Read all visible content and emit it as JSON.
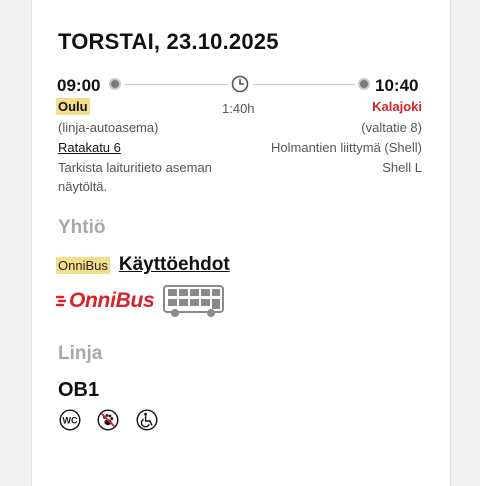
{
  "trip": {
    "date": "TORSTAI, 23.10.2025",
    "departure_time": "09:00",
    "arrival_time": "10:40",
    "duration": "1:40h",
    "origin": {
      "city": "Oulu",
      "detail": "(linja-autoasema)",
      "address": "Ratakatu 6",
      "note": "Tarkista laituritieto aseman näytöltä."
    },
    "destination": {
      "city": "Kalajoki",
      "detail": "(valtatie 8)",
      "address": "Holmantien liittymä (Shell)",
      "note": "Shell L"
    }
  },
  "company": {
    "heading": "Yhtiö",
    "badge": "OnniBus",
    "terms_link": "Käyttöehdot",
    "brand_logo_text": "OnniBus",
    "bus_icon": "double-decker-bus-icon"
  },
  "line": {
    "heading": "Linja",
    "code": "OB1",
    "amenities": [
      {
        "icon": "wc-icon",
        "text": "WC"
      },
      {
        "icon": "no-pets-icon"
      },
      {
        "icon": "wheelchair-icon"
      }
    ]
  },
  "colors": {
    "accent_red": "#d8232a",
    "highlight_yellow": "#f5de8a",
    "muted_heading": "#a8a8a8"
  }
}
